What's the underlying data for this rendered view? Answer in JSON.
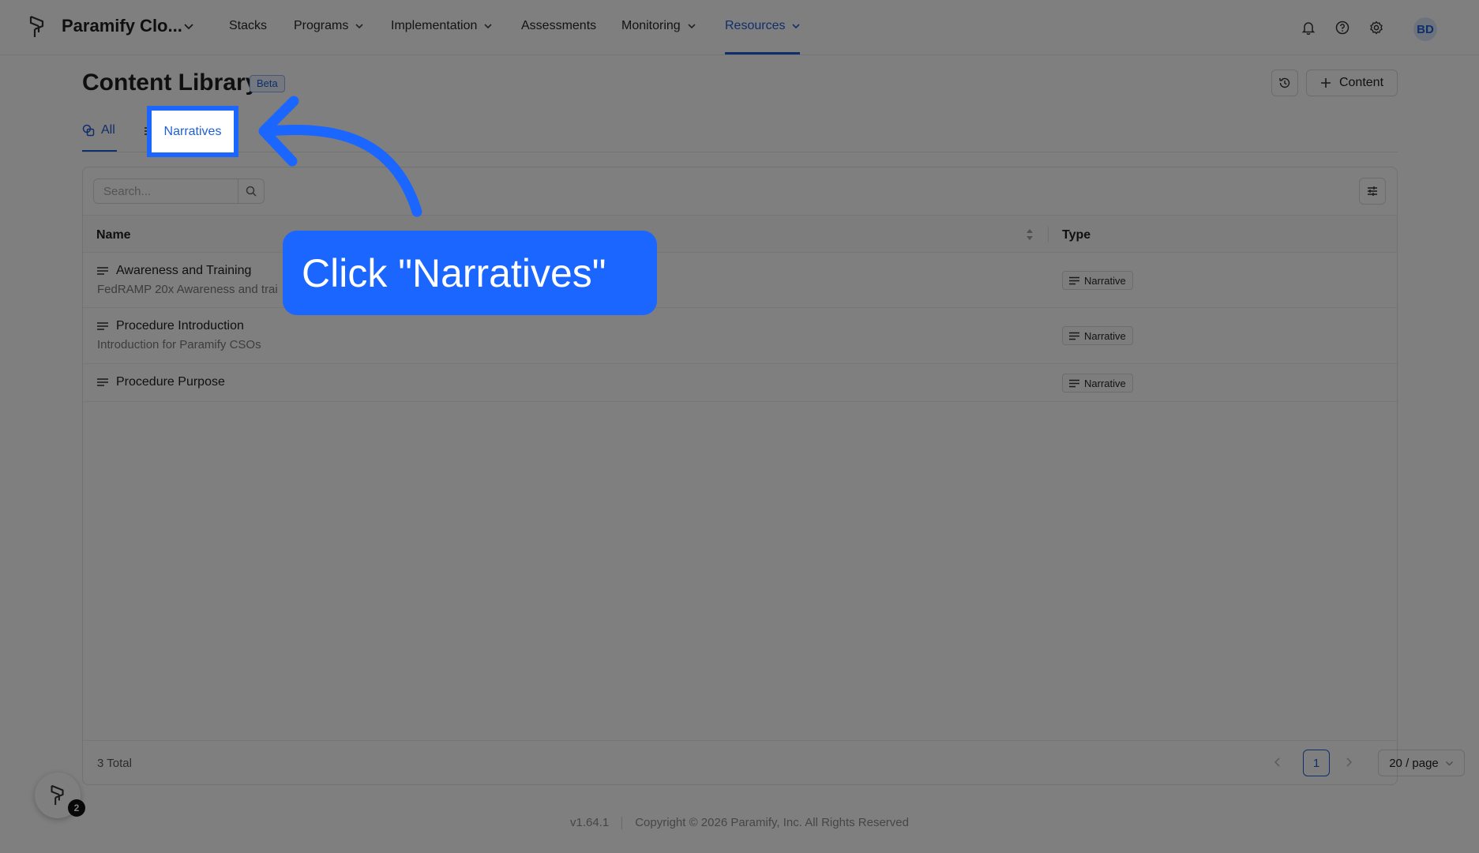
{
  "header": {
    "org_name": "Paramify Clo...",
    "nav": [
      {
        "label": "Stacks",
        "dropdown": false
      },
      {
        "label": "Programs",
        "dropdown": true
      },
      {
        "label": "Implementation",
        "dropdown": true
      },
      {
        "label": "Assessments",
        "dropdown": false
      },
      {
        "label": "Monitoring",
        "dropdown": true
      },
      {
        "label": "Resources",
        "dropdown": true,
        "active": true
      }
    ],
    "avatar_initials": "BD",
    "icons": [
      "bell-icon",
      "help-circle-icon",
      "gear-icon"
    ]
  },
  "page": {
    "title": "Content Library",
    "badge": "Beta",
    "add_button_label": "Content"
  },
  "tabs": {
    "all": "All",
    "narratives": "Narratives"
  },
  "search": {
    "placeholder": "Search..."
  },
  "table": {
    "columns": {
      "name": "Name",
      "type": "Type"
    },
    "rows": [
      {
        "name": "Awareness and Training",
        "description": "FedRAMP 20x Awareness and trai",
        "type": "Narrative"
      },
      {
        "name": "Procedure Introduction",
        "description": "Introduction for Paramify CSOs",
        "type": "Narrative"
      },
      {
        "name": "Procedure Purpose",
        "description": "",
        "type": "Narrative"
      }
    ]
  },
  "pagination": {
    "total": "3 Total",
    "current_page": "1",
    "page_size": "20 / page"
  },
  "footer": {
    "version": "v1.64.1",
    "copyright": "Copyright © 2026 Paramify, Inc. All Rights Reserved"
  },
  "help_widget": {
    "badge_count": "2"
  },
  "annotation": {
    "callout_text": "Click \"Narratives\"",
    "highlight_label": "Narratives",
    "accent_color": "#1a66ff"
  }
}
